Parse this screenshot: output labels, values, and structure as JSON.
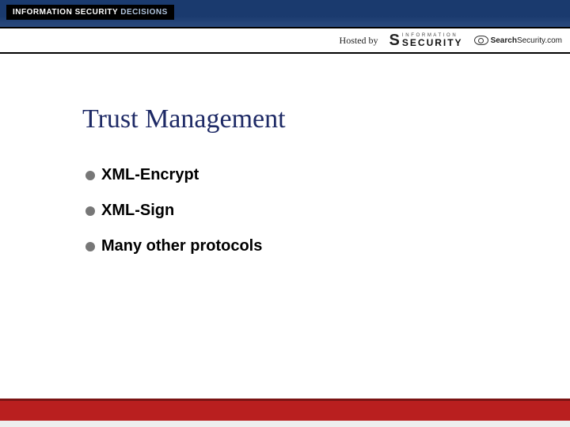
{
  "header": {
    "brand_prefix": "INFORMATION SECURITY ",
    "brand_suffix": "DECISIONS",
    "hosted_by": "Hosted by",
    "logo_security_small": "I N F O R M A T I O N",
    "logo_security_big": "SECURITY",
    "logo_searchsecurity_bold": "Search",
    "logo_searchsecurity_rest": "Security.com"
  },
  "slide": {
    "title": "Trust Management",
    "bullets": [
      "XML-Encrypt",
      "XML-Sign",
      "Many other protocols"
    ]
  }
}
